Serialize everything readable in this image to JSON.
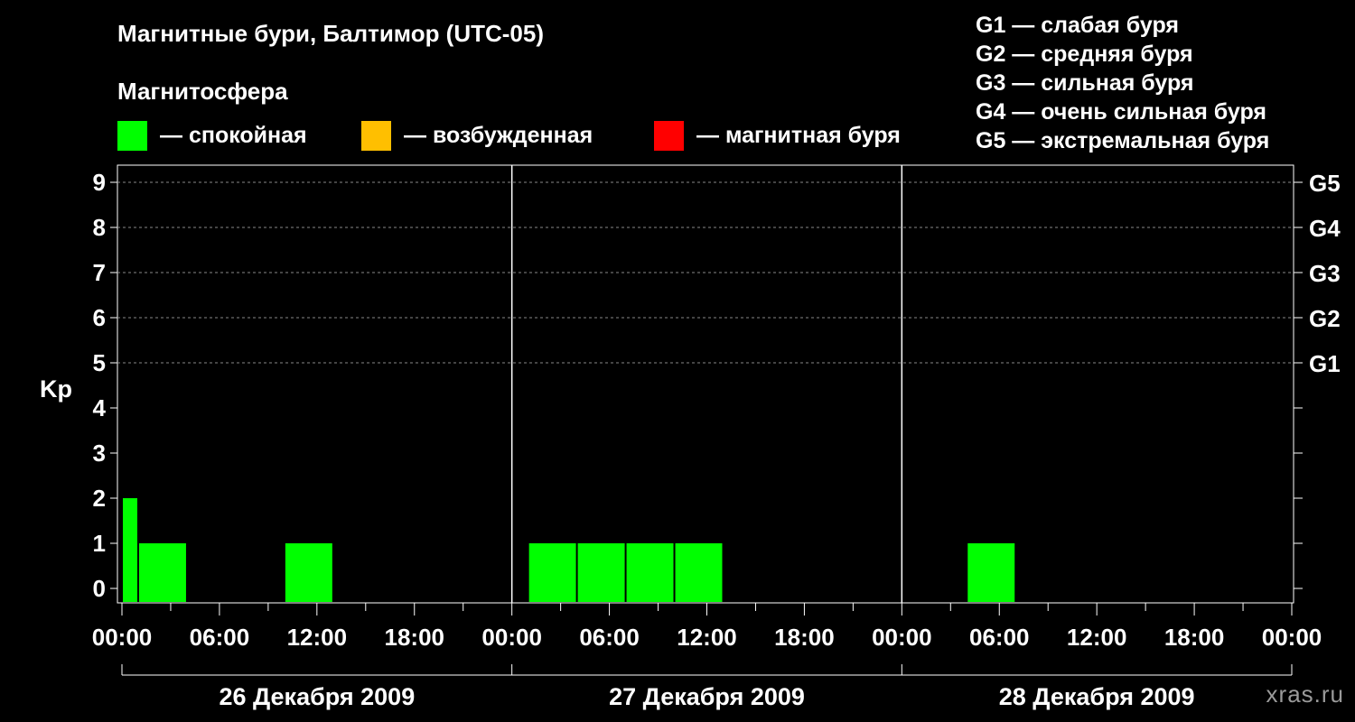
{
  "header": {
    "title": "Магнитные бури, Балтимор (UTC-05)",
    "subtitle": "Магнитосфера"
  },
  "legend": [
    {
      "label": "— спокойная",
      "color": "#00ff00"
    },
    {
      "label": "— возбужденная",
      "color": "#ffbf00"
    },
    {
      "label": "— магнитная буря",
      "color": "#ff0000"
    }
  ],
  "g_scale": [
    "G1 — слабая буря",
    "G2 — средняя буря",
    "G3 — сильная буря",
    "G4 — очень сильная буря",
    "G5 — экстремальная буря"
  ],
  "watermark": "xras.ru",
  "chart_data": {
    "type": "bar",
    "ylabel": "Kp",
    "ylim": [
      0,
      9
    ],
    "yticks": [
      "0",
      "1",
      "2",
      "3",
      "4",
      "5",
      "6",
      "7",
      "8",
      "9"
    ],
    "right_axis": [
      {
        "kp": 5,
        "label": "G1"
      },
      {
        "kp": 6,
        "label": "G2"
      },
      {
        "kp": 7,
        "label": "G3"
      },
      {
        "kp": 8,
        "label": "G4"
      },
      {
        "kp": 9,
        "label": "G5"
      }
    ],
    "xlim_hours": [
      0,
      72
    ],
    "xtick_labels": [
      "00:00",
      "06:00",
      "12:00",
      "18:00",
      "00:00",
      "06:00",
      "12:00",
      "18:00",
      "00:00",
      "06:00",
      "12:00",
      "18:00",
      "00:00"
    ],
    "days": [
      "26 Декабря 2009",
      "27 Декабря 2009",
      "28 Декабря 2009"
    ],
    "color": "#00ff00",
    "bars": [
      {
        "start_h": 0,
        "end_h": 1,
        "kp": 2
      },
      {
        "start_h": 1,
        "end_h": 4,
        "kp": 1
      },
      {
        "start_h": 10,
        "end_h": 13,
        "kp": 1
      },
      {
        "start_h": 25,
        "end_h": 28,
        "kp": 1
      },
      {
        "start_h": 28,
        "end_h": 31,
        "kp": 1
      },
      {
        "start_h": 31,
        "end_h": 34,
        "kp": 1
      },
      {
        "start_h": 34,
        "end_h": 37,
        "kp": 1
      },
      {
        "start_h": 52,
        "end_h": 55,
        "kp": 1
      }
    ],
    "grid": "dashed at Kp 5-9"
  }
}
